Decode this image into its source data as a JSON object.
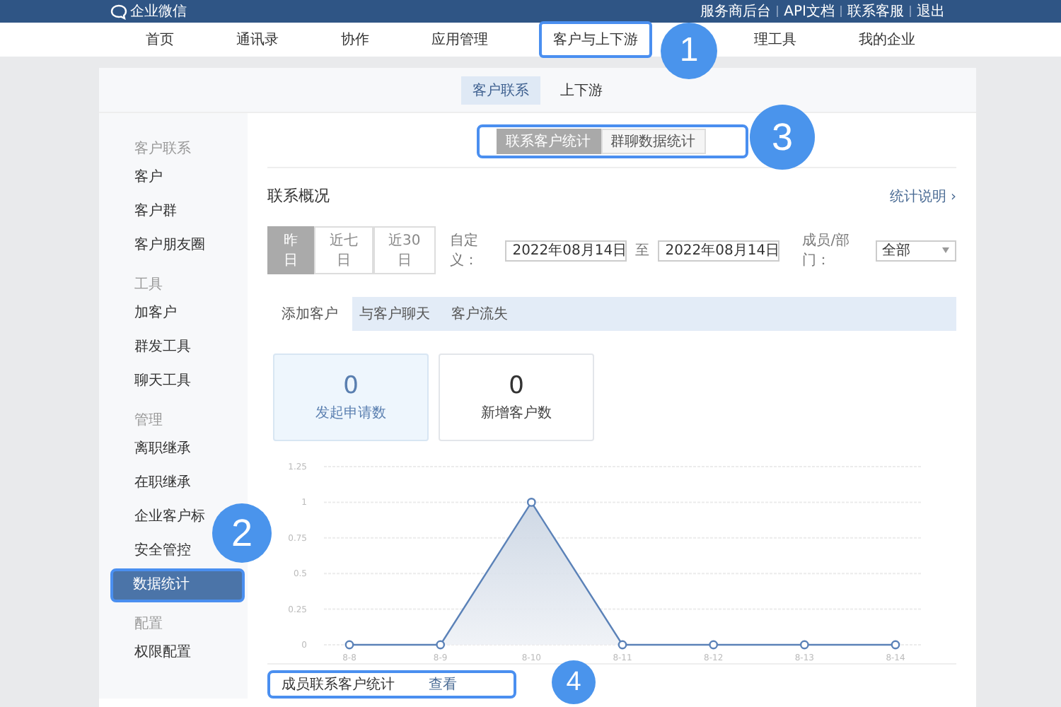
{
  "brand": {
    "name": "企业微信"
  },
  "top_links": [
    "服务商后台",
    "API文档",
    "联系客服",
    "退出"
  ],
  "nav": [
    {
      "label": "首页",
      "highlighted": false
    },
    {
      "label": "通讯录",
      "highlighted": false
    },
    {
      "label": "协作",
      "highlighted": false
    },
    {
      "label": "应用管理",
      "highlighted": false
    },
    {
      "label": "客户与上下游",
      "highlighted": true
    },
    {
      "label": "理工具",
      "highlighted": false
    },
    {
      "label": "我的企业",
      "highlighted": false
    }
  ],
  "section_tabs": [
    {
      "label": "客户联系",
      "selected": true
    },
    {
      "label": "上下游",
      "selected": false
    }
  ],
  "sidebar": [
    {
      "kind": "group",
      "label": "客户联系"
    },
    {
      "kind": "item",
      "label": "客户",
      "selected": false,
      "highlighted": false
    },
    {
      "kind": "item",
      "label": "客户群",
      "selected": false,
      "highlighted": false
    },
    {
      "kind": "item",
      "label": "客户朋友圈",
      "selected": false,
      "highlighted": false
    },
    {
      "kind": "group",
      "label": "工具"
    },
    {
      "kind": "item",
      "label": "加客户",
      "selected": false,
      "highlighted": false
    },
    {
      "kind": "item",
      "label": "群发工具",
      "selected": false,
      "highlighted": false
    },
    {
      "kind": "item",
      "label": "聊天工具",
      "selected": false,
      "highlighted": false
    },
    {
      "kind": "group",
      "label": "管理"
    },
    {
      "kind": "item",
      "label": "离职继承",
      "selected": false,
      "highlighted": false
    },
    {
      "kind": "item",
      "label": "在职继承",
      "selected": false,
      "highlighted": false
    },
    {
      "kind": "item",
      "label": "企业客户标",
      "selected": false,
      "highlighted": false
    },
    {
      "kind": "item",
      "label": "安全管控",
      "selected": false,
      "highlighted": false
    },
    {
      "kind": "item",
      "label": "数据统计",
      "selected": true,
      "highlighted": true
    },
    {
      "kind": "group",
      "label": "配置"
    },
    {
      "kind": "item",
      "label": "权限配置",
      "selected": false,
      "highlighted": false
    }
  ],
  "stat_tabs": {
    "highlighted": true,
    "items": [
      {
        "label": "联系客户统计",
        "selected": true
      },
      {
        "label": "群聊数据统计",
        "selected": false
      }
    ]
  },
  "overview": {
    "title": "联系概况",
    "help_link": "统计说明 ›",
    "ranges": [
      {
        "label": "昨日",
        "selected": true
      },
      {
        "label": "近七日",
        "selected": false
      },
      {
        "label": "近30日",
        "selected": false
      }
    ],
    "custom_label": "自定义：",
    "date_from": "2022年08月14日",
    "to_label": "至",
    "date_to": "2022年08月14日",
    "member_label": "成员/部门：",
    "member_value": "全部",
    "metric_tabs": [
      {
        "label": "添加客户",
        "selected": true
      },
      {
        "label": "与客户聊天",
        "selected": false
      },
      {
        "label": "客户流失",
        "selected": false
      }
    ],
    "cards": [
      {
        "value": "0",
        "label": "发起申请数",
        "selected": true
      },
      {
        "value": "0",
        "label": "新增客户数",
        "selected": false
      }
    ],
    "chart_data": {
      "type": "area",
      "categories": [
        "8-8",
        "8-9",
        "8-10",
        "8-11",
        "8-12",
        "8-13",
        "8-14"
      ],
      "series": [
        {
          "color": "#5b82b8",
          "values": [
            0,
            0,
            1,
            0,
            0,
            0,
            0
          ]
        }
      ],
      "grid": true,
      "ylim": [
        0,
        1.25
      ],
      "yticks": [
        0,
        0.25,
        0.5,
        0.75,
        1,
        1.25
      ]
    }
  },
  "bottom_row": {
    "highlighted": true,
    "title": "成员联系客户统计",
    "link": "查看"
  },
  "callouts": [
    "1",
    "2",
    "3",
    "4"
  ]
}
